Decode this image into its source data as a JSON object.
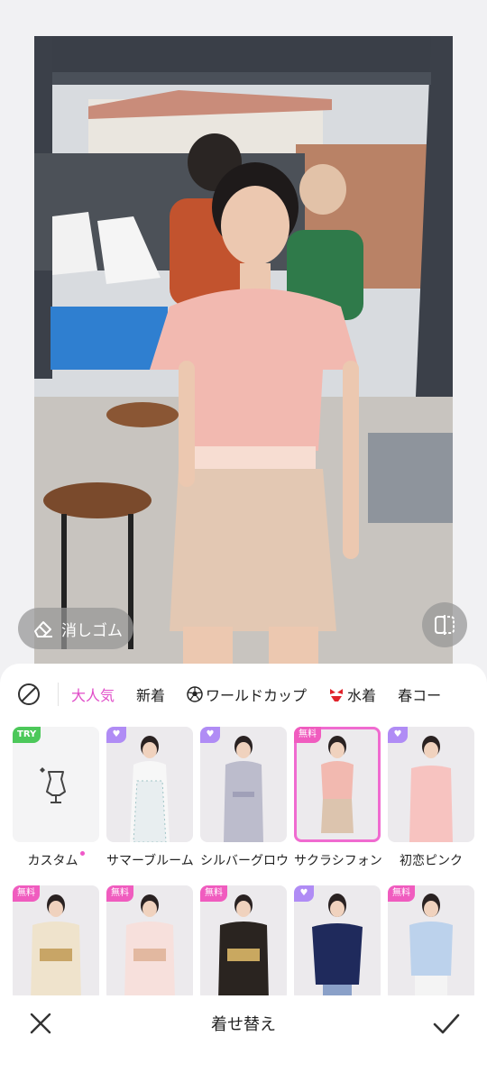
{
  "photo": {
    "eraser_label": "消しゴム",
    "icons": {
      "eraser": "eraser-icon",
      "compare": "compare-icon"
    }
  },
  "tabs": {
    "none_icon": "no-entry-icon",
    "items": [
      {
        "label": "大人気",
        "active": true
      },
      {
        "label": "新着",
        "active": false
      },
      {
        "label": "ワールドカップ",
        "active": false,
        "icon": "soccer-ball-icon"
      },
      {
        "label": "水着",
        "active": false,
        "icon": "bikini-icon"
      },
      {
        "label": "春コー",
        "active": false
      }
    ]
  },
  "outfits": {
    "row1": [
      {
        "name": "カスタム",
        "badge": "TRY",
        "new_dot": true
      },
      {
        "name": "サマーブルーム",
        "badge": "vip"
      },
      {
        "name": "シルバーグロウ",
        "badge": "vip"
      },
      {
        "name": "サクラシフォン",
        "badge": "無料",
        "selected": true
      },
      {
        "name": "初恋ピンク",
        "badge": "vip"
      }
    ],
    "row2": [
      {
        "name": "",
        "badge": "無料"
      },
      {
        "name": "",
        "badge": "無料"
      },
      {
        "name": "",
        "badge": "無料"
      },
      {
        "name": "",
        "badge": "vip"
      },
      {
        "name": "",
        "badge": "無料"
      }
    ]
  },
  "footer": {
    "title": "着せ替え",
    "close_icon": "close-icon",
    "confirm_icon": "checkmark-icon"
  },
  "colors": {
    "accent": "#e04cc8",
    "selected_border": "#f06bd0",
    "free_badge": "#f05cbf",
    "try_badge": "#4cc85a",
    "vip_badge": "#b08cf5"
  }
}
